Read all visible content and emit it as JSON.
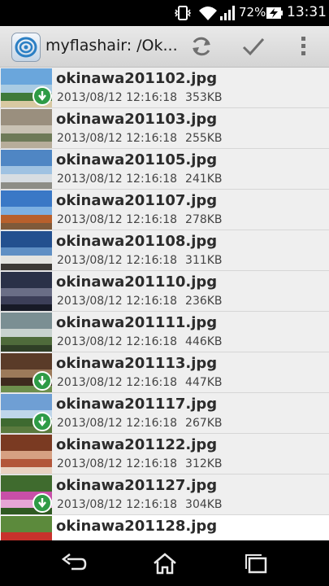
{
  "status_bar": {
    "battery_percent": "72%",
    "clock": "13:31",
    "icons": [
      "vibrate-icon",
      "wifi-icon",
      "signal-icon",
      "battery-charging-icon"
    ]
  },
  "action_bar": {
    "title": "myflashair: /Ok...",
    "app_icon": "flashair-app-icon",
    "actions": [
      "refresh-icon",
      "checkmark-icon",
      "overflow-menu-icon"
    ]
  },
  "files": [
    {
      "name": "okinawa201102.jpg",
      "date": "2013/08/12 12:16:18",
      "size": "353KB",
      "download_badge": true,
      "thumb": [
        "#6aa6dc",
        "#a9cbe3",
        "#3f7a3a",
        "#d8c9a2"
      ]
    },
    {
      "name": "okinawa201103.jpg",
      "date": "2013/08/12 12:16:18",
      "size": "255KB",
      "download_badge": false,
      "thumb": [
        "#9a8f7e",
        "#c9c2b4",
        "#6e7a58",
        "#b7ad9a"
      ]
    },
    {
      "name": "okinawa201105.jpg",
      "date": "2013/08/12 12:16:18",
      "size": "241KB",
      "download_badge": false,
      "thumb": [
        "#4f86c4",
        "#9fc2e2",
        "#d7dde2",
        "#8d8d86"
      ]
    },
    {
      "name": "okinawa201107.jpg",
      "date": "2013/08/12 12:16:18",
      "size": "278KB",
      "download_badge": false,
      "thumb": [
        "#3a78c6",
        "#7db0e2",
        "#b8602c",
        "#7f5a3a"
      ]
    },
    {
      "name": "okinawa201108.jpg",
      "date": "2013/08/12 12:16:18",
      "size": "311KB",
      "download_badge": false,
      "thumb": [
        "#23508f",
        "#5f8fc4",
        "#e4e4e0",
        "#3d3a36"
      ]
    },
    {
      "name": "okinawa201110.jpg",
      "date": "2013/08/12 12:16:18",
      "size": "236KB",
      "download_badge": false,
      "thumb": [
        "#2a3148",
        "#6a6e86",
        "#3c3f58",
        "#171a26"
      ]
    },
    {
      "name": "okinawa201111.jpg",
      "date": "2013/08/12 12:16:18",
      "size": "446KB",
      "download_badge": false,
      "thumb": [
        "#7b8f93",
        "#c8d2cf",
        "#4f6b3b",
        "#2f3f26"
      ]
    },
    {
      "name": "okinawa201113.jpg",
      "date": "2013/08/12 12:16:18",
      "size": "447KB",
      "download_badge": true,
      "thumb": [
        "#5a3b28",
        "#9c7a5a",
        "#3e2a1e",
        "#6d8f4d"
      ]
    },
    {
      "name": "okinawa201117.jpg",
      "date": "2013/08/12 12:16:18",
      "size": "267KB",
      "download_badge": true,
      "thumb": [
        "#6f9fd4",
        "#bfd6ea",
        "#3e6a30",
        "#5a7a3e"
      ]
    },
    {
      "name": "okinawa201122.jpg",
      "date": "2013/08/12 12:16:18",
      "size": "312KB",
      "download_badge": false,
      "thumb": [
        "#7a3a22",
        "#d6a082",
        "#b2563a",
        "#e8d2c2"
      ]
    },
    {
      "name": "okinawa201127.jpg",
      "date": "2013/08/12 12:16:18",
      "size": "304KB",
      "download_badge": true,
      "thumb": [
        "#3f6b2e",
        "#c84fa8",
        "#e6a6d6",
        "#2f5a22"
      ]
    },
    {
      "name": "okinawa201128.jpg",
      "date": "",
      "size": "",
      "download_badge": false,
      "thumb": [
        "#5c8a3c",
        "#c8322c",
        "#e45a48",
        "#4a7030"
      ]
    }
  ],
  "nav_bar": [
    "back-icon",
    "home-icon",
    "recent-apps-icon"
  ]
}
